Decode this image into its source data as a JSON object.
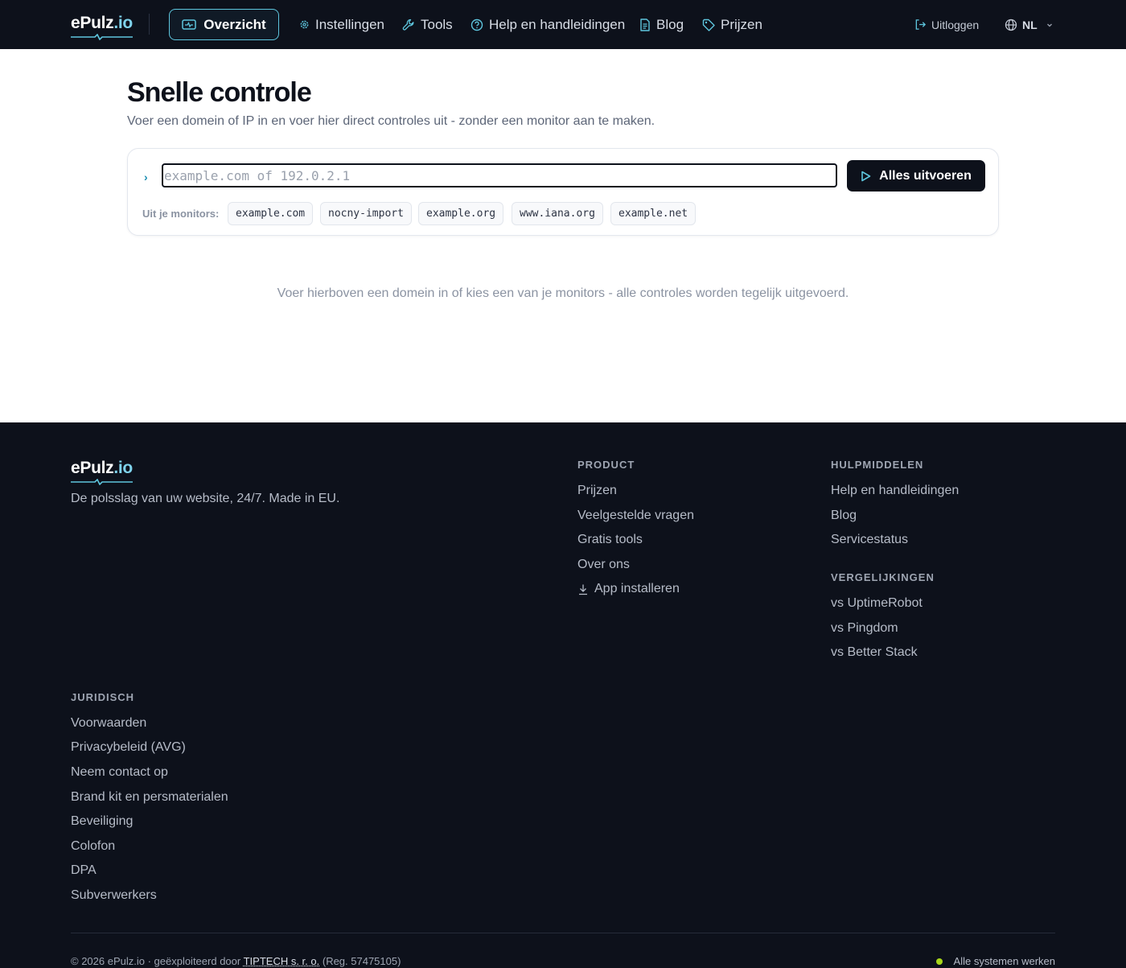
{
  "brand": {
    "name_main": "ePulz",
    "name_tld": ".io"
  },
  "nav": {
    "items": [
      {
        "label": "Overzicht",
        "icon": "monitor-icon",
        "active": true
      },
      {
        "label": "Instellingen",
        "icon": "gear-icon"
      },
      {
        "label": "Tools",
        "icon": "wrench-icon"
      },
      {
        "label": "Help en handleidingen",
        "icon": "help-circle-icon"
      },
      {
        "label": "Blog",
        "icon": "document-icon"
      },
      {
        "label": "Prijzen",
        "icon": "tag-icon"
      }
    ],
    "logout_label": "Uitloggen",
    "language": "NL"
  },
  "main": {
    "title": "Snelle controle",
    "subtitle": "Voer een domein of IP in en voer hier direct controles uit - zonder een monitor aan te maken.",
    "input": {
      "value": "",
      "placeholder": "example.com of 192.0.2.1"
    },
    "run_button": "Alles uitvoeren",
    "monitors_label": "Uit je monitors:",
    "monitors": [
      "example.com",
      "nocny-import",
      "example.org",
      "www.iana.org",
      "example.net"
    ],
    "empty_hint": "Voer hierboven een domein in of kies een van je monitors - alle controles worden tegelijk uitgevoerd."
  },
  "footer": {
    "tagline": "De polsslag van uw website, 24/7. Made in EU.",
    "product": {
      "title": "PRODUCT",
      "links": [
        "Prijzen",
        "Veelgestelde vragen",
        "Gratis tools",
        "Over ons",
        "App installeren"
      ]
    },
    "resources": {
      "title": "HULPMIDDELEN",
      "links": [
        "Help en handleidingen",
        "Blog",
        "Servicestatus"
      ]
    },
    "comparisons": {
      "title": "VERGELIJKINGEN",
      "links": [
        "vs UptimeRobot",
        "vs Pingdom",
        "vs Better Stack"
      ]
    },
    "legal": {
      "title": "JURIDISCH",
      "links": [
        "Voorwaarden",
        "Privacybeleid (AVG)",
        "Neem contact op",
        "Brand kit en persmaterialen",
        "Beveiliging",
        "Colofon",
        "DPA",
        "Subverwerkers"
      ]
    },
    "copyright_prefix": "© 2026 ePulz.io · geëxploiteerd door",
    "company": "TIPTECH s. r. o.",
    "reg": "(Reg. 57475105)",
    "status_text": "Alle systemen werken",
    "status_color": "#a8d61a"
  },
  "colors": {
    "nav_bg": "#0d111b",
    "accent": "#5ec6de",
    "footer_bg": "#0d111b"
  }
}
